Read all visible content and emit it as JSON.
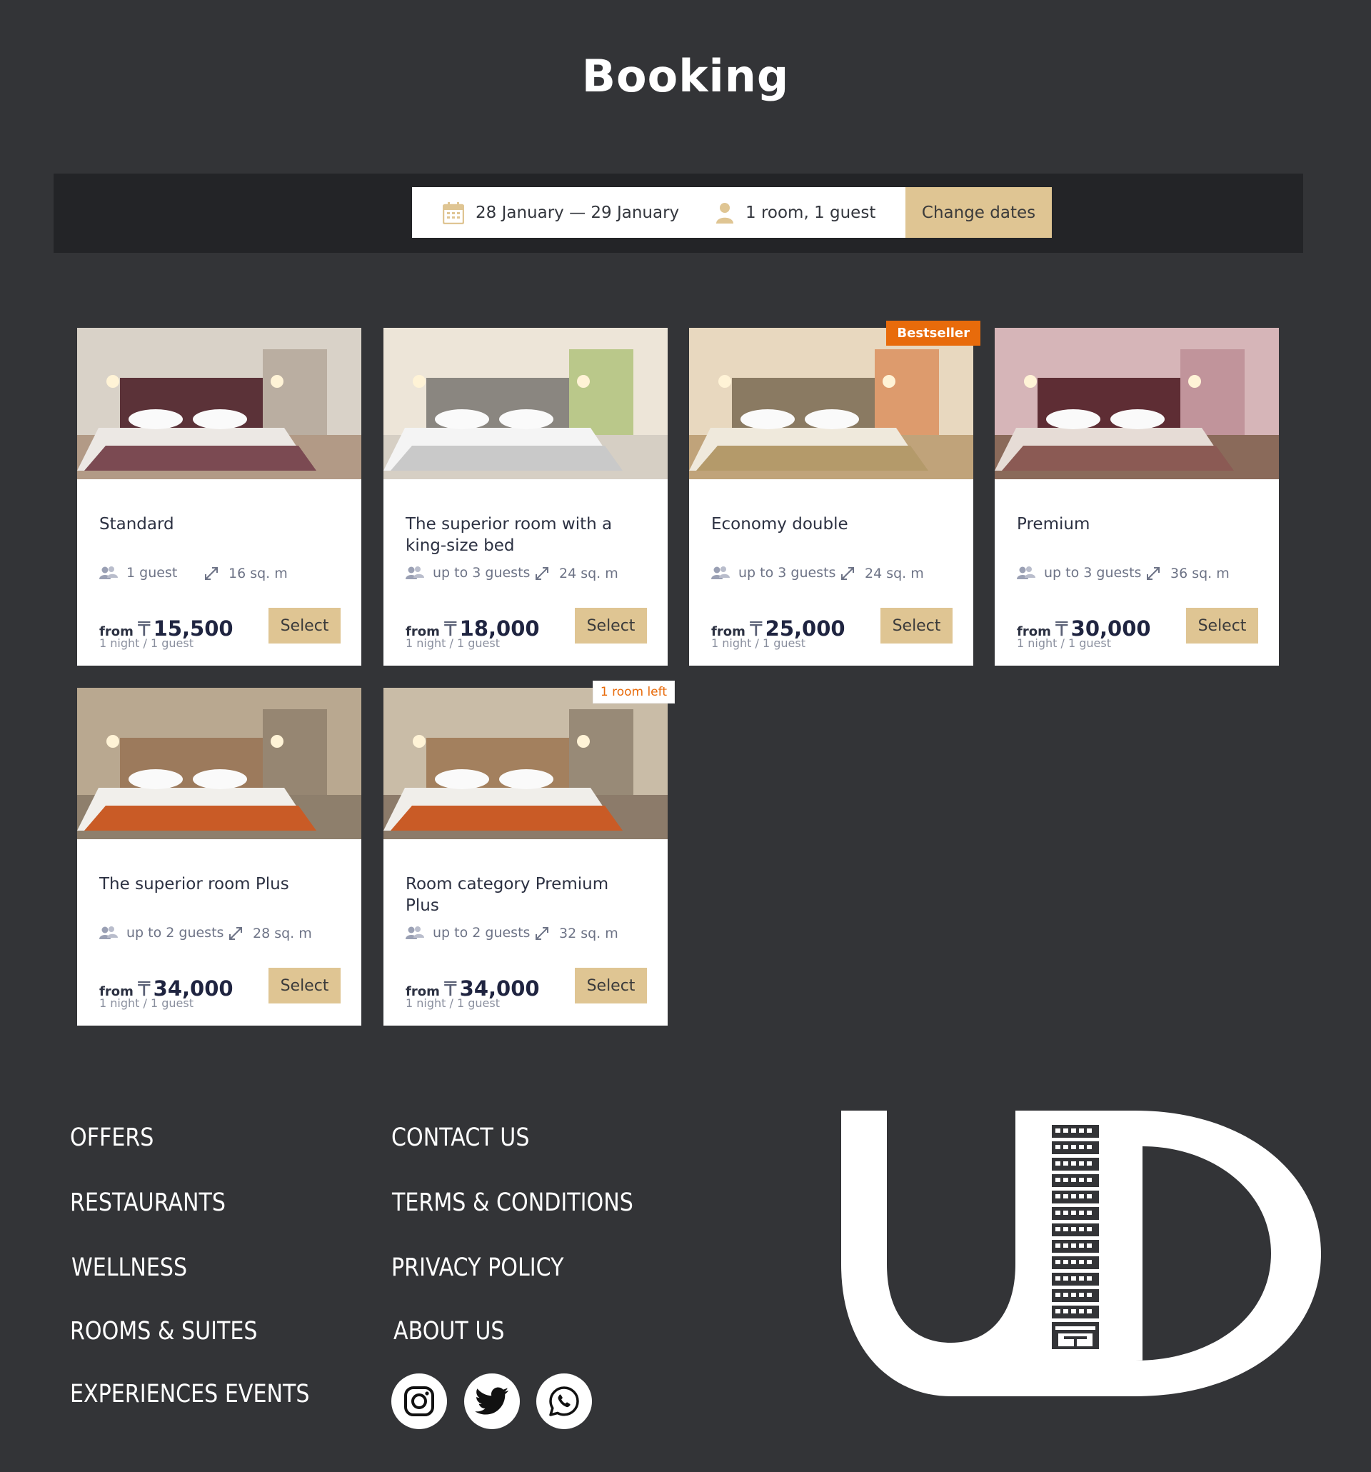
{
  "header": {
    "title": "Booking"
  },
  "search": {
    "dates": "28 January — 29 January",
    "guests": "1 room, 1 guest",
    "change_label": "Change dates"
  },
  "rooms": [
    {
      "name": "Standard",
      "guests": "1 guest",
      "area": "16 sq. m",
      "from": "from",
      "currency": "₸",
      "price": "15,500",
      "per": "1 night / 1 guest",
      "select": "Select",
      "badge": ""
    },
    {
      "name": "The superior room with a king-size bed",
      "guests": "up to 3 guests",
      "area": "24 sq. m",
      "from": "from",
      "currency": "₸",
      "price": "18,000",
      "per": "1 night / 1 guest",
      "select": "Select",
      "badge": ""
    },
    {
      "name": "Economy double",
      "guests": "up to 3 guests",
      "area": "24 sq. m",
      "from": "from",
      "currency": "₸",
      "price": "25,000",
      "per": "1 night / 1 guest",
      "select": "Select",
      "badge": "Bestseller"
    },
    {
      "name": "Premium",
      "guests": "up to 3 guests",
      "area": "36 sq. m",
      "from": "from",
      "currency": "₸",
      "price": "30,000",
      "per": "1 night / 1 guest",
      "select": "Select",
      "badge": ""
    },
    {
      "name": "The superior room Plus",
      "guests": "up to 2 guests",
      "area": "28 sq. m",
      "from": "from",
      "currency": "₸",
      "price": "34,000",
      "per": "1 night / 1 guest",
      "select": "Select",
      "badge": ""
    },
    {
      "name": "Room category Premium Plus",
      "guests": "up to 2 guests",
      "area": "32 sq. m",
      "from": "from",
      "currency": "₸",
      "price": "34,000",
      "per": "1 night / 1 guest",
      "select": "Select",
      "badge": "1 room left"
    }
  ],
  "footer": {
    "col1": [
      "OFFERS",
      "RESTAURANTS",
      "WELLNESS",
      "ROOMS & SUITES",
      "EXPERIENCES EVENTS"
    ],
    "col2": [
      "CONTACT US",
      "TERMS & CONDITIONS",
      "PRIVACY POLICY",
      "ABOUT US"
    ],
    "social": [
      "instagram-icon",
      "twitter-icon",
      "whatsapp-icon"
    ]
  },
  "colors": {
    "accent": "#dfc593",
    "badge": "#e86b0b",
    "background": "#333437",
    "bar": "#232427"
  }
}
